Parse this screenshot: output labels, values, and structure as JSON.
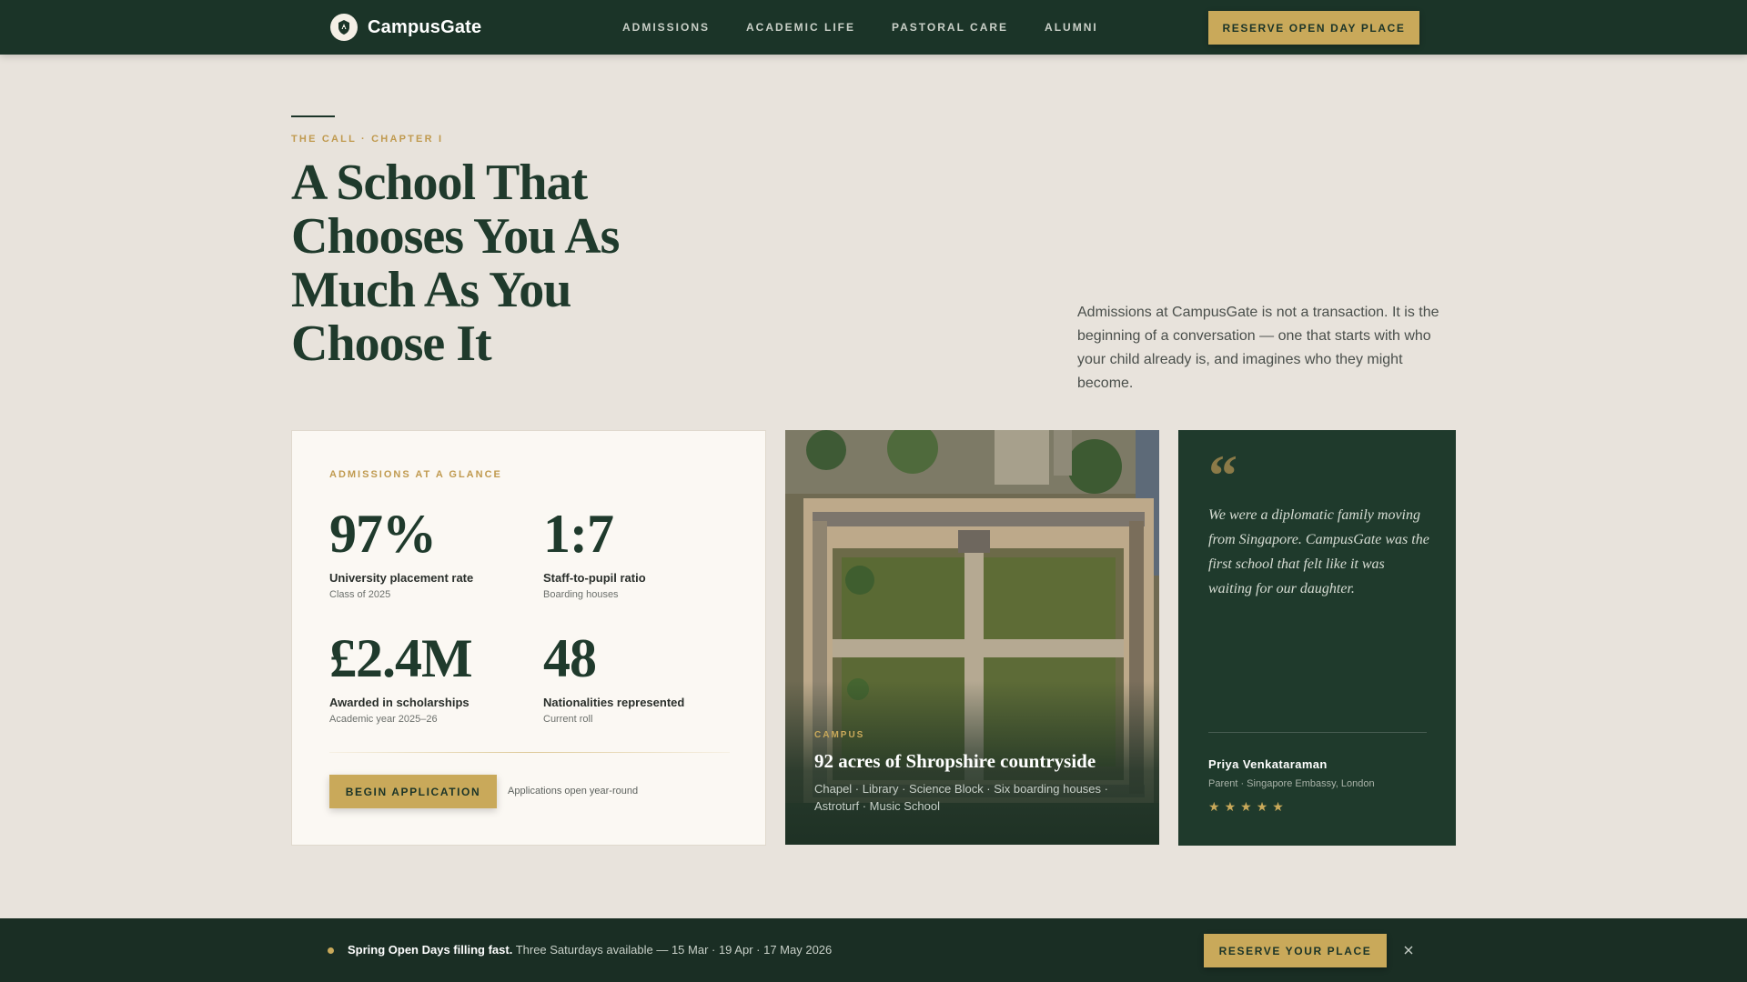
{
  "header": {
    "brand": "CampusGate",
    "nav": [
      "ADMISSIONS",
      "ACADEMIC LIFE",
      "PASTORAL CARE",
      "ALUMNI"
    ],
    "cta": "RESERVE OPEN DAY PLACE"
  },
  "hero": {
    "eyebrow": "THE CALL · CHAPTER I",
    "title": "A School That Chooses You As Much As You Choose It",
    "text": "Admissions at CampusGate is not a transaction. It is the beginning of a conversation — one that starts with who your child already is, and imagines who they might become."
  },
  "stats": {
    "eyebrow": "ADMISSIONS AT A GLANCE",
    "items": [
      {
        "value": "97%",
        "label": "University placement rate",
        "sub": "Class of 2025"
      },
      {
        "value": "1:7",
        "label": "Staff-to-pupil ratio",
        "sub": "Boarding houses"
      },
      {
        "value": "£2.4M",
        "label": "Awarded in scholarships",
        "sub": "Academic year 2025–26"
      },
      {
        "value": "48",
        "label": "Nationalities represented",
        "sub": "Current roll"
      }
    ],
    "cta": "BEGIN APPLICATION",
    "note": "Applications open year-round"
  },
  "campus": {
    "eyebrow": "CAMPUS",
    "title": "92 acres of Shropshire countryside",
    "desc": "Chapel · Library · Science Block · Six boarding houses · Astroturf · Music School"
  },
  "testimonial": {
    "quote_mark": "“",
    "quote": "We were a diplomatic family moving from Singapore. CampusGate was the first school that felt like it was waiting for our daughter.",
    "name": "Priya Venkataraman",
    "role": "Parent · Singapore Embassy, London",
    "rating": 5
  },
  "bottom_bar": {
    "bold": "Spring Open Days filling fast.",
    "text": " Three Saturdays available — 15 Mar · 19 Apr · 17 May 2026",
    "cta": "RESERVE YOUR PLACE"
  },
  "colors": {
    "primary": "#1b3428",
    "accent": "#c9a95a",
    "background": "#e8e3dc"
  }
}
